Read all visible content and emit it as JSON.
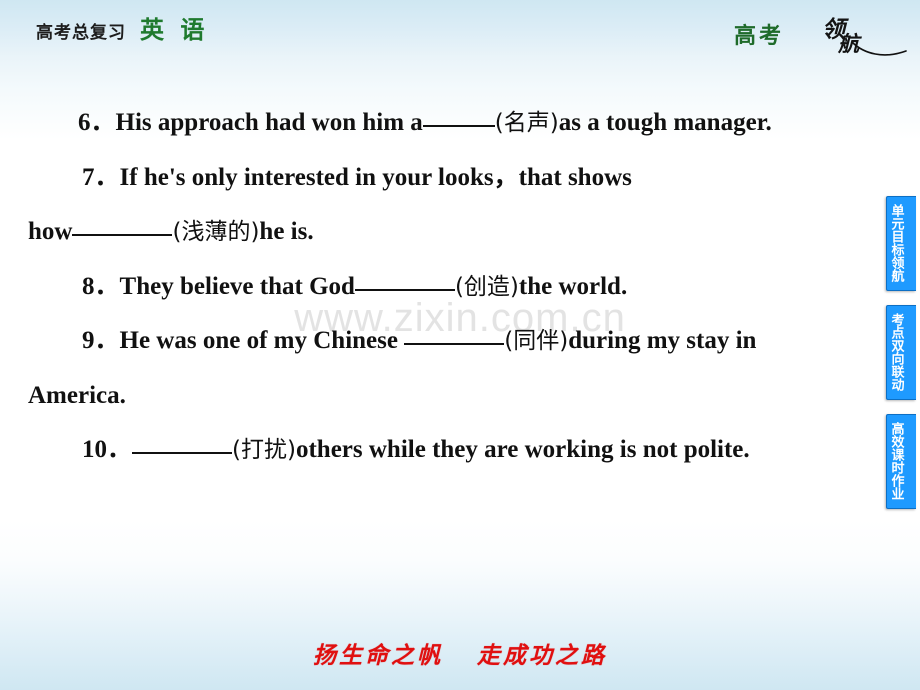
{
  "header": {
    "title_cn": "高考总复习",
    "title_subject": "英 语",
    "brand_left": "高考",
    "brand_right_top": "领",
    "brand_right_bottom": "航"
  },
  "watermark": {
    "text": "www.zixin.com.cn"
  },
  "questions": [
    {
      "number": "6．",
      "before": "His approach had won him a",
      "hint": "(名声)",
      "after": "as a tough manager.",
      "blank_class": "b-6"
    },
    {
      "number": "7．",
      "before": "If he's only interested in your looks，that shows",
      "hint": "",
      "after": "",
      "blank_class": ""
    },
    {
      "number": "",
      "before": "how",
      "hint": "(浅薄的)",
      "after": "he is.",
      "blank_class": "b-7"
    },
    {
      "number": "8．",
      "before": "They believe that God",
      "hint": "(创造)",
      "after": "the world.",
      "blank_class": "b-8"
    },
    {
      "number": "9．",
      "before": "He was one of my Chinese ",
      "hint": "(同伴)",
      "after": "during my stay in",
      "blank_class": "b-9"
    },
    {
      "number": "",
      "before": "America.",
      "hint": "",
      "after": "",
      "blank_class": ""
    },
    {
      "number": "10．",
      "before": " ",
      "hint": "(打扰)",
      "after": "others while they are working is not polite.",
      "blank_class": "b-10"
    }
  ],
  "lines": {
    "l6_num": "6．",
    "l6_a": "His approach had won him a",
    "l6_cn": "(名声)",
    "l6_b": "as a tough manager.",
    "l7_num": "7．",
    "l7_a": "If he's only interested in your looks，that shows",
    "l7b_a": "how",
    "l7b_cn": "(浅薄的)",
    "l7b_b": "he is.",
    "l8_num": "8．",
    "l8_a": "They believe that God",
    "l8_cn": "(创造)",
    "l8_b": "the world.",
    "l9_num": "9．",
    "l9_a": "He was one of my Chinese ",
    "l9_cn": "(同伴)",
    "l9_b": "during my stay in",
    "l9b": "America.",
    "l10_num": "10．",
    "l10_cn": "(打扰)",
    "l10_b": "others while they are working is not polite."
  },
  "side_tabs": [
    {
      "label": "单元目标领航"
    },
    {
      "label": "考点双向联动"
    },
    {
      "label": "高效课时作业"
    }
  ],
  "footer": {
    "left": "扬生命之帆",
    "right": "走成功之路"
  },
  "colors": {
    "accent_blue": "#1e9aff",
    "header_green": "#1f7a2e",
    "footer_red": "#e01010",
    "watermark_gray": "#e3e3e3",
    "gradient_top": "#cfe7f2"
  }
}
